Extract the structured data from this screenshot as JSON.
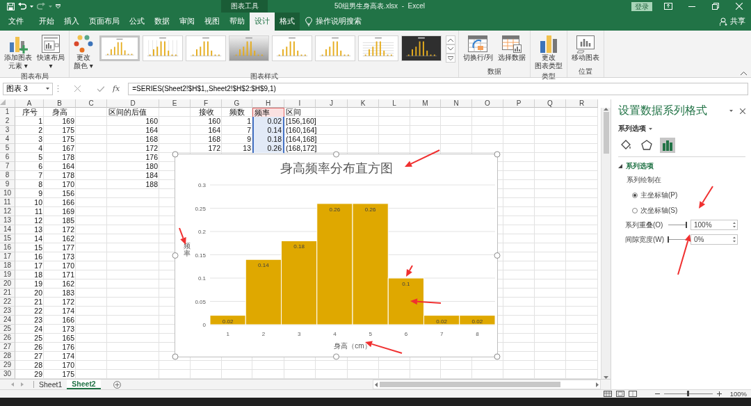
{
  "title_bar": {
    "context_group": "图表工具",
    "title": "50组男生身高表.xlsx  -  Excel",
    "sign_in": "登录"
  },
  "ribbon_tabs": [
    {
      "label": "文件",
      "selected": false,
      "contextual": false
    },
    {
      "label": "开始",
      "selected": false,
      "contextual": false
    },
    {
      "label": "插入",
      "selected": false,
      "contextual": false
    },
    {
      "label": "页面布局",
      "selected": false,
      "contextual": false
    },
    {
      "label": "公式",
      "selected": false,
      "contextual": false
    },
    {
      "label": "数据",
      "selected": false,
      "contextual": false
    },
    {
      "label": "审阅",
      "selected": false,
      "contextual": false
    },
    {
      "label": "视图",
      "selected": false,
      "contextual": false
    },
    {
      "label": "帮助",
      "selected": false,
      "contextual": false
    },
    {
      "label": "设计",
      "selected": true,
      "contextual": true
    },
    {
      "label": "格式",
      "selected": false,
      "contextual": true
    }
  ],
  "tell_me": "操作说明搜索",
  "share": "共享",
  "ribbon_groups": [
    {
      "label": "图表布局",
      "buttons": [
        {
          "kind": "add-element",
          "lines": [
            "添加图表",
            "元素 ▾"
          ]
        },
        {
          "kind": "quick-layout",
          "lines": [
            "快速布局",
            "▾"
          ]
        }
      ]
    },
    {
      "label": "图表样式",
      "buttons": [
        {
          "kind": "colors",
          "lines": [
            "更改",
            "颜色 ▾"
          ]
        }
      ],
      "styles": [
        {
          "kind": "white",
          "selected": true
        },
        {
          "kind": "vgrid",
          "selected": false
        },
        {
          "kind": "white",
          "selected": false
        },
        {
          "kind": "gray",
          "selected": false
        },
        {
          "kind": "white",
          "selected": false
        },
        {
          "kind": "white",
          "selected": false
        },
        {
          "kind": "hatched",
          "selected": false
        },
        {
          "kind": "dark",
          "selected": false
        }
      ]
    },
    {
      "label": "数据",
      "buttons": [
        {
          "kind": "switch",
          "lines": [
            "切换行/列"
          ]
        },
        {
          "kind": "select-data",
          "lines": [
            "选择数据"
          ]
        }
      ]
    },
    {
      "label": "类型",
      "buttons": [
        {
          "kind": "chart-type",
          "lines": [
            "更改",
            "图表类型"
          ]
        }
      ]
    },
    {
      "label": "位置",
      "buttons": [
        {
          "kind": "move-chart",
          "lines": [
            "移动图表"
          ]
        }
      ]
    }
  ],
  "formula_bar": {
    "name_box": "图表 3",
    "function_button": "fx",
    "formula": "=SERIES(Sheet2!$H$1,,Sheet2!$H$2:$H$9,1)"
  },
  "sheet": {
    "columns": [
      "A",
      "B",
      "C",
      "D",
      "E",
      "F",
      "G",
      "H",
      "I",
      "J",
      "K",
      "L",
      "M",
      "N",
      "O",
      "P",
      "Q",
      "R"
    ],
    "rows": [
      {
        "label": "1",
        "cells": {
          "A": "序号",
          "B": "身高",
          "D": "区间的后值",
          "F": "接收",
          "G": "频数",
          "H": {
            "text": "频率",
            "kind": "series-name"
          },
          "I": "区间"
        }
      },
      {
        "label": "2",
        "cells": {
          "A": "1",
          "B": "169",
          "D": "160",
          "F": "160",
          "G": "1",
          "H": {
            "text": "0.02",
            "kind": "series-values"
          },
          "I": "[156,160]"
        }
      },
      {
        "label": "3",
        "cells": {
          "A": "2",
          "B": "175",
          "D": "164",
          "F": "164",
          "G": "7",
          "H": {
            "text": "0.14",
            "kind": "series-values"
          },
          "I": "(160,164]"
        }
      },
      {
        "label": "4",
        "cells": {
          "A": "3",
          "B": "175",
          "D": "168",
          "F": "168",
          "G": "9",
          "H": {
            "text": "0.18",
            "kind": "series-values"
          },
          "I": "(164,168]"
        }
      },
      {
        "label": "5",
        "cells": {
          "A": "4",
          "B": "167",
          "D": "172",
          "F": "172",
          "G": "13",
          "H": {
            "text": "0.26",
            "kind": "series-values"
          },
          "I": "(168,172]"
        }
      },
      {
        "label": "6",
        "cells": {
          "A": "5",
          "B": "178",
          "D": "176"
        }
      },
      {
        "label": "7",
        "cells": {
          "A": "6",
          "B": "164",
          "D": "180"
        }
      },
      {
        "label": "8",
        "cells": {
          "A": "7",
          "B": "178",
          "D": "184"
        }
      },
      {
        "label": "9",
        "cells": {
          "A": "8",
          "B": "170",
          "D": "188"
        }
      },
      {
        "label": "10",
        "cells": {
          "A": "9",
          "B": "156"
        }
      },
      {
        "label": "11",
        "cells": {
          "A": "10",
          "B": "166"
        }
      },
      {
        "label": "12",
        "cells": {
          "A": "11",
          "B": "169"
        }
      },
      {
        "label": "13",
        "cells": {
          "A": "12",
          "B": "185"
        }
      },
      {
        "label": "14",
        "cells": {
          "A": "13",
          "B": "172"
        }
      },
      {
        "label": "15",
        "cells": {
          "A": "14",
          "B": "162"
        }
      },
      {
        "label": "16",
        "cells": {
          "A": "15",
          "B": "177"
        }
      },
      {
        "label": "17",
        "cells": {
          "A": "16",
          "B": "173"
        }
      },
      {
        "label": "18",
        "cells": {
          "A": "17",
          "B": "170"
        }
      },
      {
        "label": "19",
        "cells": {
          "A": "18",
          "B": "171"
        }
      },
      {
        "label": "20",
        "cells": {
          "A": "19",
          "B": "162"
        }
      },
      {
        "label": "21",
        "cells": {
          "A": "20",
          "B": "183"
        }
      },
      {
        "label": "22",
        "cells": {
          "A": "21",
          "B": "172"
        }
      },
      {
        "label": "23",
        "cells": {
          "A": "22",
          "B": "174"
        }
      },
      {
        "label": "24",
        "cells": {
          "A": "23",
          "B": "166"
        }
      },
      {
        "label": "25",
        "cells": {
          "A": "24",
          "B": "173"
        }
      },
      {
        "label": "26",
        "cells": {
          "A": "25",
          "B": "165"
        }
      },
      {
        "label": "27",
        "cells": {
          "A": "26",
          "B": "176"
        }
      },
      {
        "label": "28",
        "cells": {
          "A": "27",
          "B": "174"
        }
      },
      {
        "label": "29",
        "cells": {
          "A": "28",
          "B": "170"
        }
      },
      {
        "label": "30",
        "cells": {
          "A": "29",
          "B": "175"
        }
      }
    ]
  },
  "chart": {
    "chart_data": {
      "type": "bar",
      "title": "身高频率分布直方图",
      "xlabel": "身高（cm）",
      "ylabel": "频率",
      "categories": [
        "1",
        "2",
        "3",
        "4",
        "5",
        "6",
        "7",
        "8"
      ],
      "series": [
        {
          "color": "#dfa800",
          "values": [
            0.02,
            0.14,
            0.18,
            0.26,
            0.26,
            0.1,
            0.02,
            0.02
          ]
        }
      ],
      "ylim": [
        0,
        0.3
      ],
      "yticks": [
        0,
        0.05,
        0.1,
        0.15,
        0.2,
        0.25,
        0.3
      ],
      "data_labels": true,
      "grid": true
    }
  },
  "sheet_tabs": [
    {
      "label": "Sheet1",
      "selected": false
    },
    {
      "label": "Sheet2",
      "selected": true
    }
  ],
  "format_pane": {
    "title": "设置数据系列格式",
    "dropdown": "系列选项",
    "tabs": [
      {
        "kind": "fill",
        "selected": false
      },
      {
        "kind": "effects",
        "selected": false
      },
      {
        "kind": "series",
        "selected": true
      }
    ],
    "section": {
      "label": "系列选项",
      "expanded": true
    },
    "plot_on_label": "系列绘制在",
    "axes": [
      {
        "label": "主坐标轴(P)",
        "selected": true
      },
      {
        "label": "次坐标轴(S)",
        "selected": false
      }
    ],
    "settings": [
      {
        "label": "系列重叠(O)",
        "level": 1,
        "value": "100%"
      },
      {
        "label": "间隙宽度(W)",
        "level": 0,
        "value": "0%"
      }
    ]
  },
  "status_bar": {
    "zoom": "100%",
    "zoom_slider": {
      "level": 0.5
    }
  }
}
